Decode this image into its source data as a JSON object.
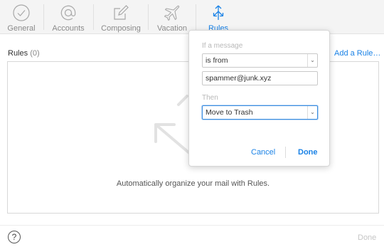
{
  "toolbar": {
    "tabs": [
      {
        "label": "General",
        "icon": "checkmark-circle-icon"
      },
      {
        "label": "Accounts",
        "icon": "at-sign-icon"
      },
      {
        "label": "Composing",
        "icon": "compose-icon"
      },
      {
        "label": "Vacation",
        "icon": "airplane-icon"
      },
      {
        "label": "Rules",
        "icon": "rules-arrows-icon",
        "active": true
      }
    ]
  },
  "rules": {
    "title": "Rules",
    "count": "(0)",
    "add_label": "Add a Rule…",
    "empty_message": "Automatically organize your mail with Rules."
  },
  "popover": {
    "if_label": "If a message",
    "condition_value": "is from",
    "address_value": "spammer@junk.xyz",
    "then_label": "Then",
    "action_value": "Move to Trash",
    "cancel_label": "Cancel",
    "done_label": "Done"
  },
  "footer": {
    "help_label": "?",
    "done_label": "Done"
  },
  "colors": {
    "accent": "#1a82e6",
    "toolbar_bg": "#f4f4f4",
    "disabled": "#c6c6c6"
  }
}
